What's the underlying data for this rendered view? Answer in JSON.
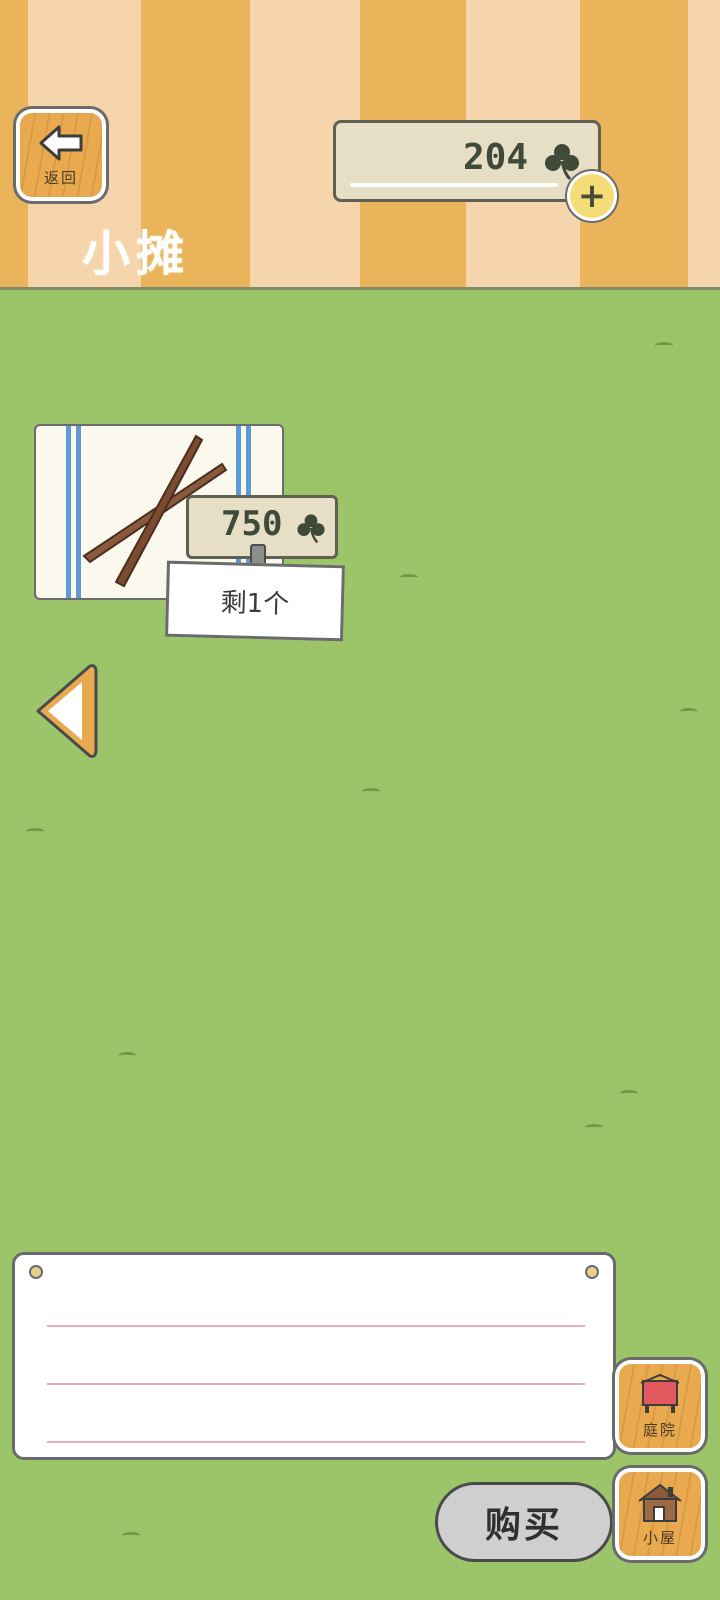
{
  "header": {
    "back_label": "返回",
    "currency_value": "204",
    "page_title": "小摊"
  },
  "item": {
    "price": "750",
    "stock_text": "剩1个"
  },
  "notes": {
    "text": ""
  },
  "actions": {
    "buy_label": "购买",
    "yard_label": "庭院",
    "house_label": "小屋"
  },
  "colors": {
    "grass": "#9cc469",
    "wall_orange": "#e9b45a",
    "wall_cream": "#f6d5ac",
    "wood": "#e8a94f",
    "towel_stripe": "#5e9ad6",
    "note_rule": "#e8aeb4"
  },
  "icons": {
    "back": "arrow-left-icon",
    "currency": "clover-icon",
    "add": "plus-icon",
    "prev": "triangle-left-icon",
    "yard": "yard-icon",
    "house": "house-icon"
  }
}
